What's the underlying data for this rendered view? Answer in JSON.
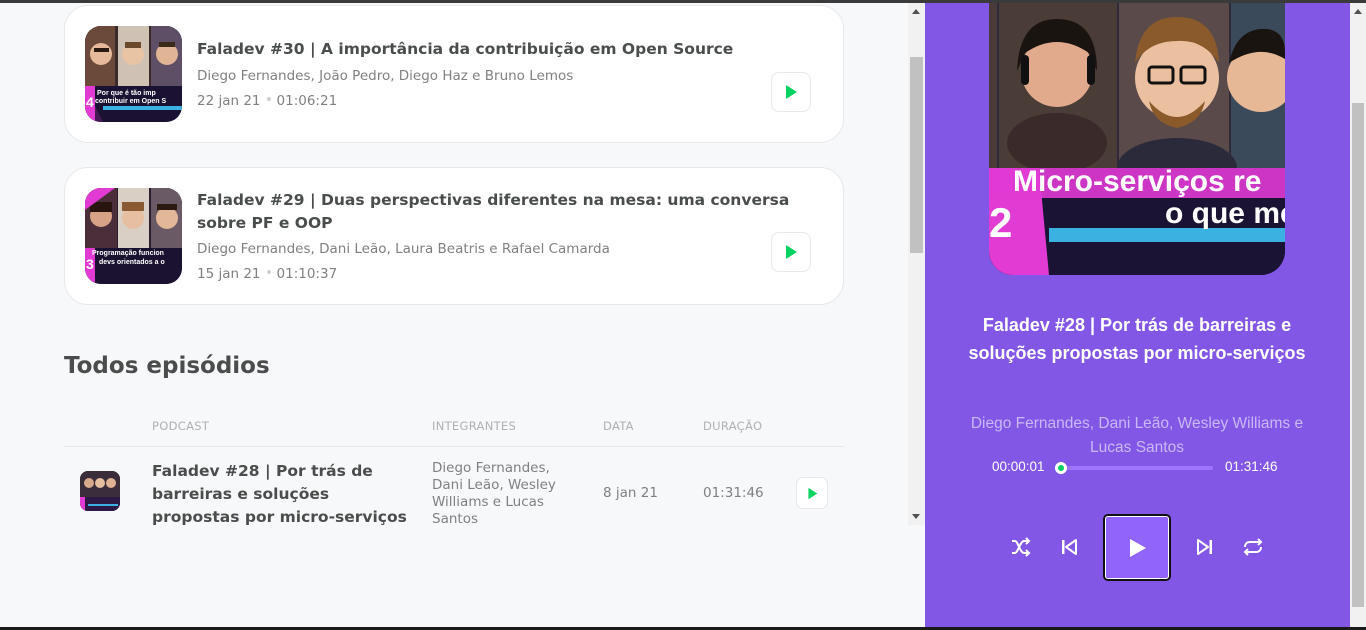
{
  "episodes": [
    {
      "title": "Faladev #30 | A importância da contribuição em Open Source",
      "members": "Diego Fernandes, João Pedro, Diego Haz e Bruno Lemos",
      "date": "22 jan 21",
      "duration": "01:06:21",
      "thumb_number": "4",
      "thumb_caption_1": "Por que é tão imp",
      "thumb_caption_2": "contribuir em Open S"
    },
    {
      "title": "Faladev #29 | Duas perspectivas diferentes na mesa: uma conversa sobre PF e OOP",
      "members": "Diego Fernandes, Dani Leão, Laura Beatris e Rafael Camarda",
      "date": "15 jan 21",
      "duration": "01:10:37",
      "thumb_number": "3",
      "thumb_caption_1": "Programação funcion",
      "thumb_caption_2": "devs orientados a o"
    }
  ],
  "all_episodes": {
    "title": "Todos episódios",
    "headers": [
      "PODCAST",
      "INTEGRANTES",
      "DATA",
      "DURAÇÃO"
    ],
    "rows": [
      {
        "title": "Faladev #28 | Por trás de barreiras e soluções propostas por micro-serviços",
        "members": "Diego Fernandes, Dani Leão, Wesley Williams e Lucas Santos",
        "date": "8 jan 21",
        "duration": "01:31:46"
      }
    ]
  },
  "player": {
    "cover_caption_1": "Micro-serviços re",
    "cover_caption_2": "o que me",
    "cover_number": "2",
    "title": "Faladev #28 | Por trás de barreiras e soluções propostas por micro-serviços",
    "members": "Diego Fernandes, Dani Leão, Wesley Williams e Lucas Santos",
    "current_time": "00:00:01",
    "total_time": "01:31:46",
    "progress": 0.0,
    "controls": [
      "shuffle-icon",
      "skip-previous-icon",
      "play-icon",
      "skip-next-icon",
      "repeat-icon"
    ]
  },
  "colors": {
    "accent_green": "#04d361",
    "player_purple": "#8257e5",
    "text_dark": "#494d4b",
    "text_muted": "#808080"
  }
}
